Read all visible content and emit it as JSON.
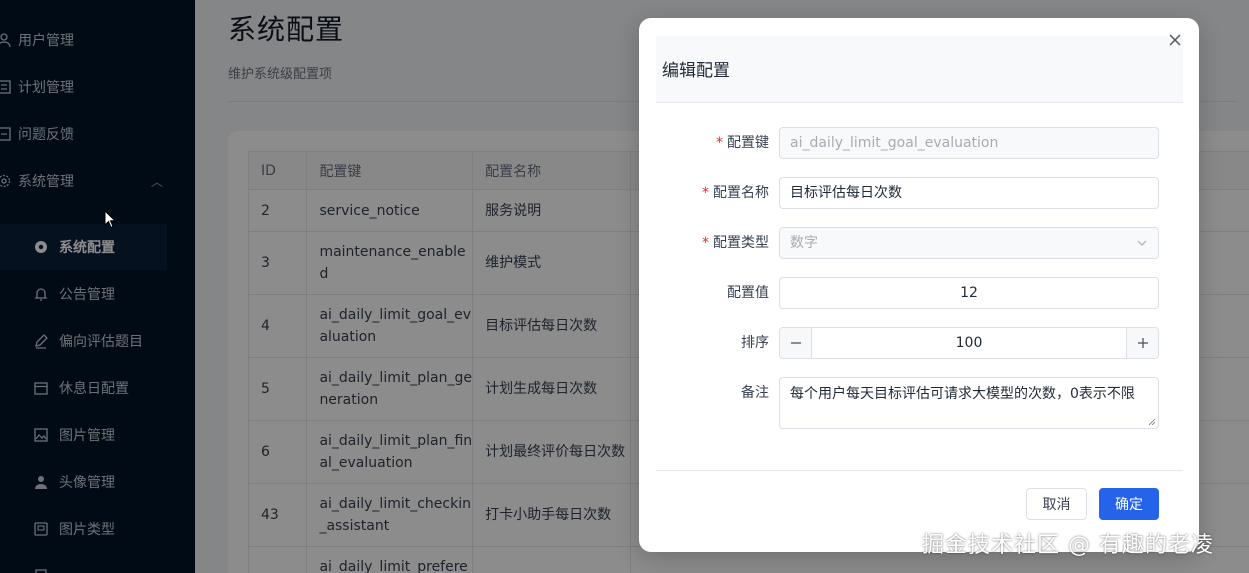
{
  "sidebar": {
    "items": [
      {
        "label": "用户管理",
        "icon": "user-icon"
      },
      {
        "label": "计划管理",
        "icon": "plan-icon"
      },
      {
        "label": "问题反馈",
        "icon": "feedback-icon"
      },
      {
        "label": "系统管理",
        "icon": "gear-icon",
        "expanded": true
      }
    ],
    "subitems": [
      {
        "label": "系统配置",
        "icon": "gear-icon",
        "active": true
      },
      {
        "label": "公告管理",
        "icon": "bell-icon"
      },
      {
        "label": "偏向评估题目",
        "icon": "edit-icon"
      },
      {
        "label": "休息日配置",
        "icon": "calendar-icon"
      },
      {
        "label": "图片管理",
        "icon": "image-icon"
      },
      {
        "label": "头像管理",
        "icon": "avatar-icon"
      },
      {
        "label": "图片类型",
        "icon": "category-icon"
      }
    ]
  },
  "page": {
    "title": "系统配置",
    "subtitle": "维护系统级配置项"
  },
  "table": {
    "headers": [
      "ID",
      "配置键",
      "配置名称"
    ],
    "rows": [
      {
        "id": "2",
        "key": "service_notice",
        "name": "服务说明"
      },
      {
        "id": "3",
        "key": "maintenance_enable\nd",
        "name": "维护模式"
      },
      {
        "id": "4",
        "key": "ai_daily_limit_goal_ev\naluation",
        "name": "目标评估每日次数"
      },
      {
        "id": "5",
        "key": "ai_daily_limit_plan_ge\nneration",
        "name": "计划生成每日次数"
      },
      {
        "id": "6",
        "key": "ai_daily_limit_plan_fin\nal_evaluation",
        "name": "计划最终评价每日次数"
      },
      {
        "id": "43",
        "key": "ai_daily_limit_checkin\n_assistant",
        "name": "打卡小助手每日次数"
      },
      {
        "id": "",
        "key": "ai_daily_limit_prefere",
        "name": ""
      }
    ]
  },
  "modal": {
    "title": "编辑配置",
    "fields": {
      "key": {
        "label": "配置键",
        "required": true,
        "value": "ai_daily_limit_goal_evaluation"
      },
      "name": {
        "label": "配置名称",
        "required": true,
        "value": "目标评估每日次数"
      },
      "type": {
        "label": "配置类型",
        "required": true,
        "value": "数字"
      },
      "value": {
        "label": "配置值",
        "value": "12"
      },
      "sort": {
        "label": "排序",
        "value": "100"
      },
      "remark": {
        "label": "备注",
        "value": "每个用户每天目标评估可请求大模型的次数，0表示不限"
      }
    },
    "cancel_label": "取消",
    "ok_label": "确定"
  },
  "watermark": "掘金技术社区 @ 有趣的老凌",
  "colors": {
    "primary": "#2563eb",
    "sidebar_bg": "#001529",
    "required": "#f5222d"
  }
}
